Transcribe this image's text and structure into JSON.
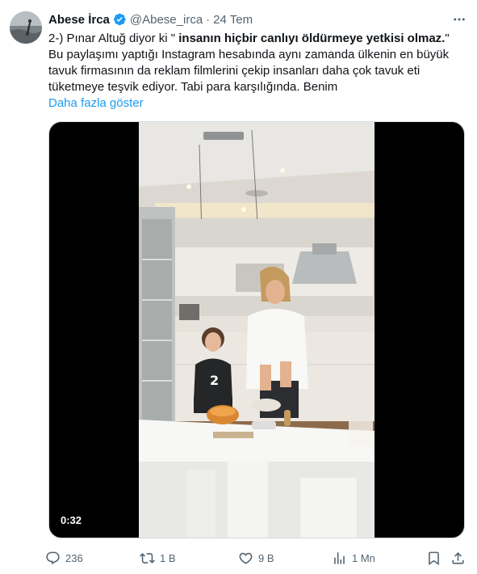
{
  "tweet": {
    "author_name": "Abese İrca",
    "author_handle": "@Abese_irca",
    "separator": "·",
    "time": "24 Tem",
    "text_line1_pre": "2-) Pınar Altuğ diyor ki \" ",
    "text_line1_bold": "insanın hiçbir canlıyı öldürmeye yetkisi olmaz.",
    "text_line1_post": "\"",
    "text_line2": "Bu paylaşımı yaptığı Instagram hesabında aynı zamanda ülkenin en büyük",
    "text_line3": "tavuk firmasının da reklam filmlerini çekip insanları daha çok tavuk eti",
    "text_line4": "tüketmeye teşvik ediyor. Tabi para karşılığında. Benim",
    "show_more": "Daha fazla göster",
    "video_duration": "0:32"
  },
  "actions": {
    "reply_count": "236",
    "retweet_count": "1 B",
    "like_count": "9 B",
    "views_count": "1 Mn"
  },
  "colors": {
    "accent": "#1d9bf0",
    "secondary_text": "#536471",
    "primary_text": "#0f1419"
  },
  "icons": [
    "verified-badge-icon",
    "more-icon",
    "reply-icon",
    "retweet-icon",
    "like-icon",
    "views-icon",
    "bookmark-icon",
    "share-icon"
  ]
}
